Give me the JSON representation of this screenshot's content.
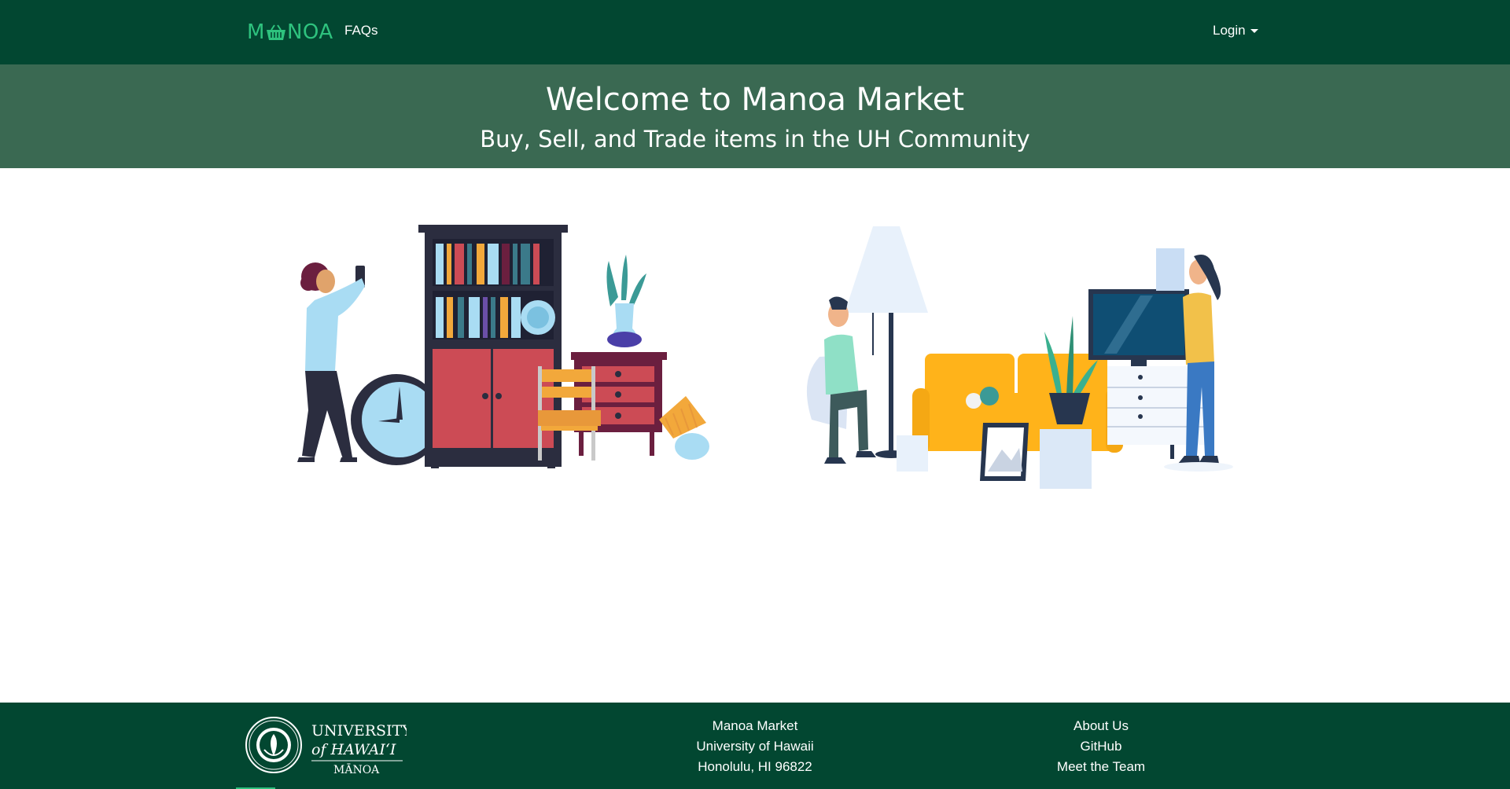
{
  "navbar": {
    "brand_left": "M",
    "brand_right": "NOA",
    "basket_icon": "basket-icon",
    "faq_label": "FAQs",
    "login_label": "Login"
  },
  "hero": {
    "title": "Welcome to Manoa Market",
    "subtitle": "Buy, Sell, and Trade items in the UH Community"
  },
  "footer": {
    "logo": {
      "line1": "UNIVERSITY",
      "line2": "of HAWAIʻI",
      "line3": "MĀNOA"
    },
    "address": [
      "Manoa Market",
      "University of Hawaii",
      "Honolulu, HI 96822"
    ],
    "links": [
      "About Us",
      "GitHub",
      "Meet the Team"
    ]
  },
  "colors": {
    "navbar_bg": "#024731",
    "hero_bg": "#3a6952",
    "brand_green": "#2ec27e",
    "footer_bg": "#024731"
  }
}
